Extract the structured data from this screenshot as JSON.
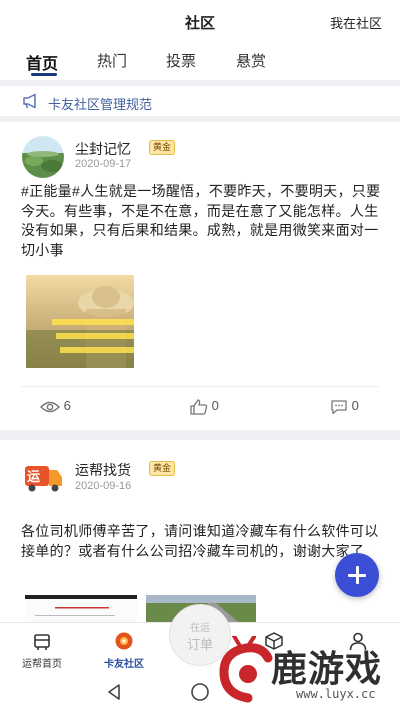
{
  "header": {
    "title": "社区",
    "right_link": "我在社区"
  },
  "tabs": [
    {
      "label": "首页",
      "active": true
    },
    {
      "label": "热门",
      "active": false
    },
    {
      "label": "投票",
      "active": false
    },
    {
      "label": "悬赏",
      "active": false
    }
  ],
  "notice": {
    "icon": "megaphone-icon",
    "text": "卡友社区管理规范"
  },
  "posts": [
    {
      "username": "尘封记忆",
      "badge": "黄金",
      "date": "2020-09-17",
      "content": "#正能量#人生就是一场醒悟，不要昨天，不要明天，只要今天。有些事，不是不在意，而是在意了又能怎样。人生没有如果，只有后果和结果。成熟，就是用微笑来面对一切小事",
      "views": "6",
      "likes": "0",
      "comments": "0"
    },
    {
      "username": "运帮找货",
      "badge": "黄金",
      "date": "2020-09-16",
      "content": "各位司机师傅辛苦了，请问谁知道冷藏车有什么软件可以接单的？或者有什么公司招冷藏车司机的，谢谢大家了"
    }
  ],
  "bottom_nav": [
    {
      "label": "运帮首页",
      "icon": "home-icon",
      "active": false
    },
    {
      "label": "卡友社区",
      "icon": "community-icon",
      "active": true
    },
    {
      "label": "",
      "icon": "box-icon",
      "active": false
    },
    {
      "label": "",
      "icon": "user-icon",
      "active": false
    }
  ],
  "center_button": {
    "line1": "在运",
    "line2": "订单"
  },
  "watermark": {
    "text": "鹿游戏",
    "url": "www.luyx.cc"
  },
  "colors": {
    "accent": "#3a4fd6",
    "tab_underline": "#1a3a7a",
    "notice_text": "#3f5f9f",
    "badge_bg": "#fde7a7"
  }
}
